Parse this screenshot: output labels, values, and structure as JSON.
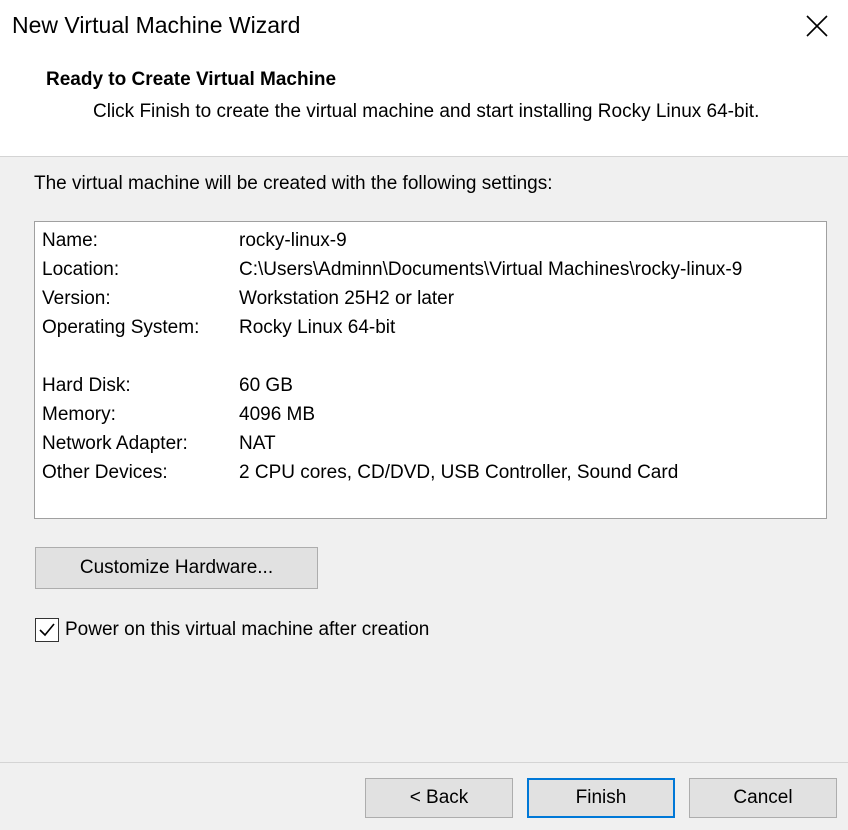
{
  "window": {
    "title": "New Virtual Machine Wizard",
    "close_icon": "close-icon"
  },
  "header": {
    "title": "Ready to Create Virtual Machine",
    "description": "Click Finish to create the virtual machine and start installing Rocky Linux 64-bit."
  },
  "intro": "The virtual machine will be created with the following settings:",
  "settings": [
    {
      "label": "Name:",
      "value": "rocky-linux-9"
    },
    {
      "label": "Location:",
      "value": "C:\\Users\\Adminn\\Documents\\Virtual Machines\\rocky-linux-9"
    },
    {
      "label": "Version:",
      "value": "Workstation 25H2 or later"
    },
    {
      "label": "Operating System:",
      "value": "Rocky Linux 64-bit"
    },
    {
      "label": "Hard Disk:",
      "value": "60 GB"
    },
    {
      "label": "Memory:",
      "value": "4096 MB"
    },
    {
      "label": "Network Adapter:",
      "value": "NAT"
    },
    {
      "label": "Other Devices:",
      "value": "2 CPU cores, CD/DVD, USB Controller, Sound Card"
    }
  ],
  "customize_button": "Customize Hardware...",
  "power_on": {
    "label": "Power on this virtual machine after creation",
    "checked": true
  },
  "footer": {
    "back": "< Back",
    "finish": "Finish",
    "cancel": "Cancel"
  },
  "colors": {
    "accent": "#0078d7",
    "background": "#f0f0f0"
  }
}
